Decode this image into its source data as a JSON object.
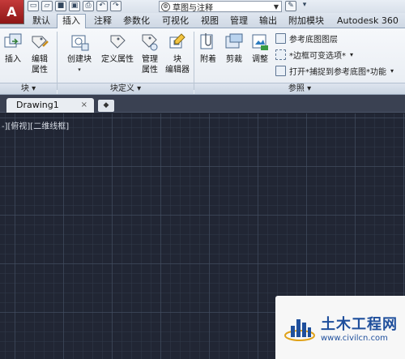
{
  "app": {
    "logo_letter": "A"
  },
  "qat": {
    "icons": [
      "new-icon",
      "open-icon",
      "save-icon",
      "save-as-icon",
      "print-icon",
      "undo-icon",
      "redo-icon"
    ],
    "workspace_label": "草图与注释",
    "extra_icons": [
      "share-icon",
      "dropdown-icon"
    ]
  },
  "tabs": [
    {
      "label": "默认",
      "active": false
    },
    {
      "label": "插入",
      "active": true
    },
    {
      "label": "注释",
      "active": false
    },
    {
      "label": "参数化",
      "active": false
    },
    {
      "label": "可视化",
      "active": false
    },
    {
      "label": "视图",
      "active": false
    },
    {
      "label": "管理",
      "active": false
    },
    {
      "label": "输出",
      "active": false
    },
    {
      "label": "附加模块",
      "active": false
    },
    {
      "label": "Autodesk 360",
      "active": false
    }
  ],
  "ribbon": {
    "block_panel": {
      "footer": "块 ▾",
      "tools": [
        {
          "label": "插入",
          "label2": ""
        },
        {
          "label": "编辑",
          "label2": "属性"
        }
      ]
    },
    "block_def_panel": {
      "footer": "块定义 ▾",
      "tools": [
        {
          "label": "创建块",
          "label2": ""
        },
        {
          "label": "定义属性",
          "label2": ""
        },
        {
          "label": "管理",
          "label2": "属性"
        },
        {
          "label": "块",
          "label2": "编辑器"
        }
      ]
    },
    "reference_panel": {
      "footer": "参照 ▾",
      "tools": [
        {
          "label": "附着"
        },
        {
          "label": "剪裁"
        },
        {
          "label": "调整"
        }
      ],
      "rows": [
        {
          "label": "参考底图图层"
        },
        {
          "label": "*边框可变选项*"
        },
        {
          "label": "打开*捕捉到参考底图*功能"
        }
      ]
    }
  },
  "drawing_tabs": {
    "active": "Drawing1",
    "close": "×",
    "new": "◆"
  },
  "canvas": {
    "view_label": "-][俯视][二维线框]"
  },
  "watermark": {
    "title": "土木工程网",
    "url": "www.civilcn.com"
  }
}
